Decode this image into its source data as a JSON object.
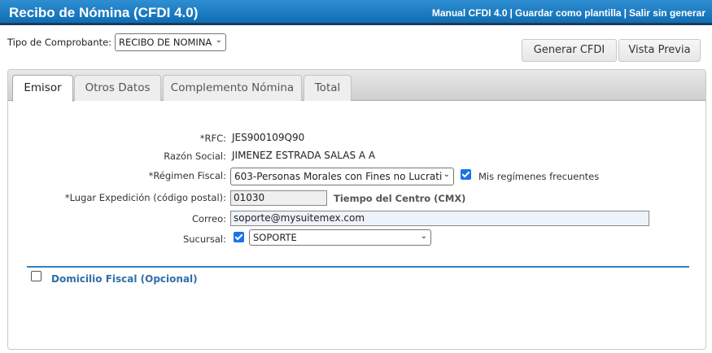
{
  "window": {
    "title": "Recibo de Nómina (CFDI 4.0)",
    "links": [
      "Manual CFDI 4.0",
      "Guardar como plantilla",
      "Salir sin generar"
    ],
    "separator": "|"
  },
  "header": {
    "tipo_label": "Tipo de Comprobante:",
    "tipo_value": "RECIBO DE NOMINA",
    "generar_label": "Generar CFDI",
    "vista_label": "Vista Previa"
  },
  "tabs": [
    {
      "label": "Emisor",
      "active": true
    },
    {
      "label": "Otros Datos",
      "active": false
    },
    {
      "label": "Complemento Nómina",
      "active": false
    },
    {
      "label": "Total",
      "active": false
    }
  ],
  "form": {
    "rfc_label": "*RFC:",
    "rfc_value": "JES900109Q90",
    "razon_label": "Razón Social:",
    "razon_value": "JIMENEZ ESTRADA SALAS A A",
    "regimen_label": "*Régimen Fiscal:",
    "regimen_value": "603-Personas Morales con Fines no Lucrati",
    "regimen_freq_label": "Mis regímenes frecuentes",
    "lugar_label": "*Lugar Expedición (código postal):",
    "lugar_value": "01030",
    "lugar_hint": "Tiempo del Centro (CMX)",
    "correo_label": "Correo:",
    "correo_value": "soporte@mysuitemex.com",
    "sucursal_label": "Sucursal:",
    "sucursal_value": "SOPORTE"
  },
  "domicilio": {
    "label": "Domicilio Fiscal (Opcional)"
  },
  "colors": {
    "title_bar": "#1573bc",
    "accent_link": "#2f6ea8",
    "checkbox_checked": "#1a73e8"
  }
}
